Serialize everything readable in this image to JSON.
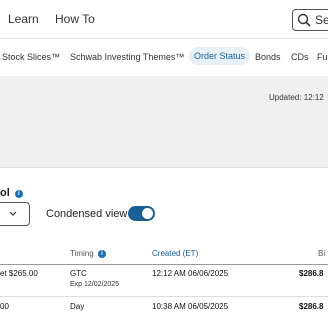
{
  "topnav": {
    "learn": "Learn",
    "how_to": "How To",
    "search_text": "Se"
  },
  "subnav": {
    "items": [
      {
        "label": "Stock Slices™"
      },
      {
        "label": "Schwab Investing Themes™"
      },
      {
        "label": "Order Status",
        "active": true
      },
      {
        "label": "Bonds"
      },
      {
        "label": "CDs"
      },
      {
        "label": "Fu"
      }
    ]
  },
  "banner": {
    "updated": "Updated: 12:12"
  },
  "filters": {
    "symbol_label_tail": "ol",
    "condensed_view_label": "Condensed view",
    "condensed_view_on": true
  },
  "table": {
    "headers": {
      "timing": "Timing",
      "created": "Created (ET)",
      "bid": "Bi"
    },
    "rows": [
      {
        "price": "et $265.00",
        "timing": "GTC",
        "timing_sub": "Exp 12/02/2025",
        "created": "12:12 AM 06/06/2025",
        "bid": "$286.8"
      },
      {
        "price": "00",
        "timing": "Day",
        "created": "10:38 AM 06/05/2025",
        "bid": "$286.8"
      }
    ]
  },
  "colors": {
    "accent": "#1a5f96",
    "info_dot": "#1a6fb3",
    "banner_bg": "#f0f0f0"
  }
}
